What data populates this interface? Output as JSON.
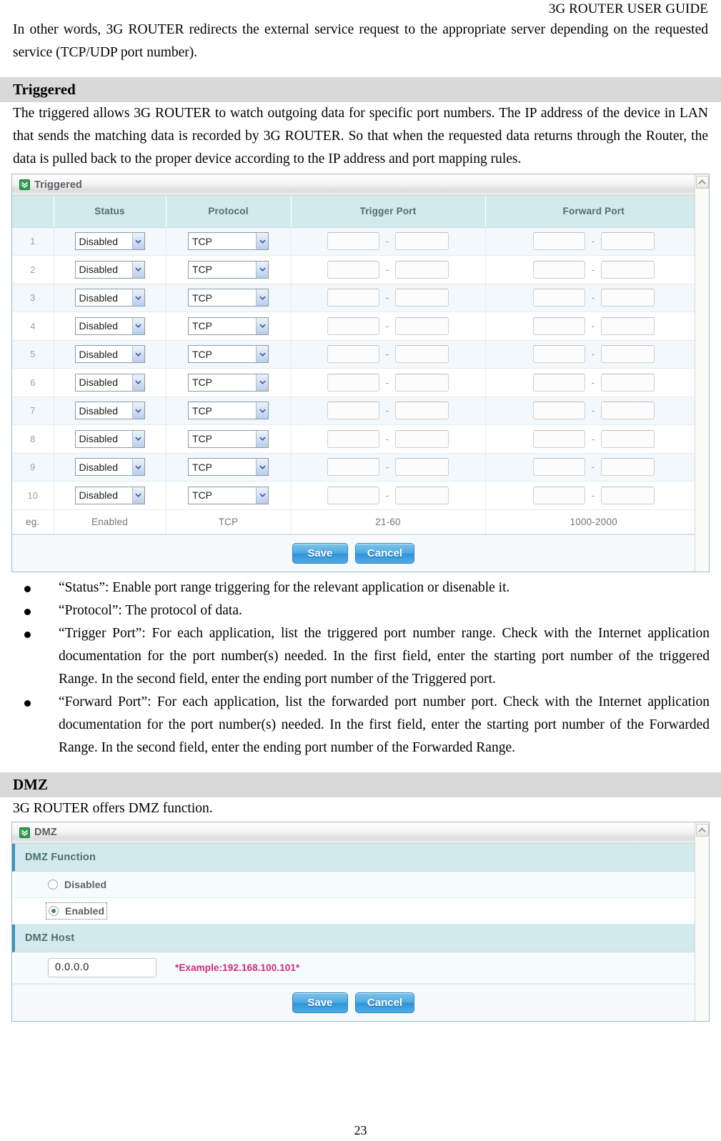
{
  "document": {
    "running_head": "3G ROUTER USER GUIDE",
    "page_number": "23",
    "intro_paragraph": "In other words, 3G ROUTER redirects the external service request to the appropriate server depending on the requested service (TCP/UDP port number).",
    "sections": [
      {
        "heading": "Triggered",
        "paragraph": "The triggered allows 3G ROUTER to watch outgoing data for specific port numbers. The IP address of the device in LAN that sends the matching data is recorded by 3G ROUTER. So that when the requested data returns through the Router, the data is pulled back to the proper device according to the IP address and port mapping rules."
      },
      {
        "heading": "DMZ",
        "paragraph": "3G ROUTER offers DMZ function."
      }
    ],
    "bullets": [
      "“Status”: Enable port range triggering for the relevant application or disenable it.",
      "“Protocol”: The protocol of data.",
      "“Trigger Port”: For each application, list the triggered port number range. Check with the Internet application documentation for the port number(s) needed. In the first field, enter the starting port number of the triggered Range. In the second field, enter the ending port number of the Triggered port.",
      "“Forward Port”: For each application, list the forwarded port number port. Check with the Internet application documentation for the port number(s) needed. In the first field, enter the starting port number of the Forwarded Range. In the second field, enter the ending port number of the Forwarded Range."
    ]
  },
  "triggered_panel": {
    "title": "Triggered",
    "title_icon": "green-chevron-down-icon",
    "scroll_up_icon": "chevron-up-icon",
    "columns": [
      "",
      "Status",
      "Protocol",
      "Trigger Port",
      "Forward Port"
    ],
    "rows": [
      {
        "index": "1",
        "status": "Disabled",
        "protocol": "TCP",
        "trigger_start": "",
        "trigger_end": "",
        "forward_start": "",
        "forward_end": ""
      },
      {
        "index": "2",
        "status": "Disabled",
        "protocol": "TCP",
        "trigger_start": "",
        "trigger_end": "",
        "forward_start": "",
        "forward_end": ""
      },
      {
        "index": "3",
        "status": "Disabled",
        "protocol": "TCP",
        "trigger_start": "",
        "trigger_end": "",
        "forward_start": "",
        "forward_end": ""
      },
      {
        "index": "4",
        "status": "Disabled",
        "protocol": "TCP",
        "trigger_start": "",
        "trigger_end": "",
        "forward_start": "",
        "forward_end": ""
      },
      {
        "index": "5",
        "status": "Disabled",
        "protocol": "TCP",
        "trigger_start": "",
        "trigger_end": "",
        "forward_start": "",
        "forward_end": ""
      },
      {
        "index": "6",
        "status": "Disabled",
        "protocol": "TCP",
        "trigger_start": "",
        "trigger_end": "",
        "forward_start": "",
        "forward_end": ""
      },
      {
        "index": "7",
        "status": "Disabled",
        "protocol": "TCP",
        "trigger_start": "",
        "trigger_end": "",
        "forward_start": "",
        "forward_end": ""
      },
      {
        "index": "8",
        "status": "Disabled",
        "protocol": "TCP",
        "trigger_start": "",
        "trigger_end": "",
        "forward_start": "",
        "forward_end": ""
      },
      {
        "index": "9",
        "status": "Disabled",
        "protocol": "TCP",
        "trigger_start": "",
        "trigger_end": "",
        "forward_start": "",
        "forward_end": ""
      },
      {
        "index": "10",
        "status": "Disabled",
        "protocol": "TCP",
        "trigger_start": "",
        "trigger_end": "",
        "forward_start": "",
        "forward_end": ""
      }
    ],
    "example_row": {
      "index": "eg.",
      "status": "Enabled",
      "protocol": "TCP",
      "trigger": "21-60",
      "forward": "1000-2000"
    },
    "range_separator": "-",
    "save_label": "Save",
    "cancel_label": "Cancel"
  },
  "dmz_panel": {
    "title": "DMZ",
    "title_icon": "green-chevron-down-icon",
    "scroll_up_icon": "chevron-up-icon",
    "function_section_label": "DMZ Function",
    "option_disabled": "Disabled",
    "option_enabled": "Enabled",
    "selected_option": "Enabled",
    "host_section_label": "DMZ Host",
    "host_value": "0.0.0.0",
    "host_example": "*Example:192.168.100.101*",
    "save_label": "Save",
    "cancel_label": "Cancel"
  },
  "colors": {
    "section_heading_bg": "#d9d9d9",
    "panel_header_bg": "#d2eaec",
    "row_odd_bg": "#f2f8fc",
    "button_blue": "#2e94d8",
    "accent_green": "#2e9b4f",
    "example_pink": "#d2297a"
  }
}
